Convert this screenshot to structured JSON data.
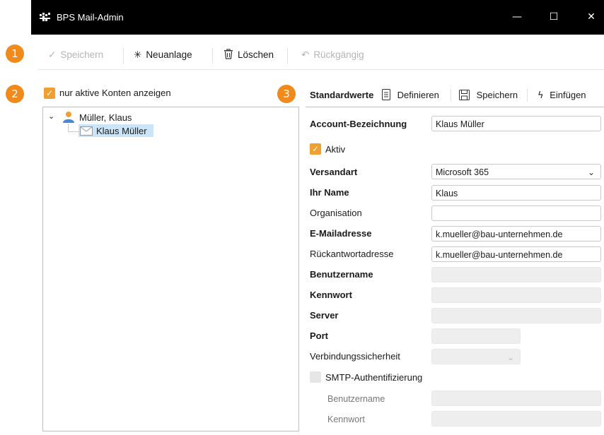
{
  "window": {
    "title": "BPS Mail-Admin",
    "minimize_glyph": "—",
    "maximize_glyph": "☐",
    "close_glyph": "✕"
  },
  "badges": [
    "1",
    "2",
    "3"
  ],
  "toolbar": {
    "save_label": "Speichern",
    "new_label": "Neuanlage",
    "delete_label": "Löschen",
    "undo_label": "Rückgängig",
    "save_icon": "check-icon",
    "new_icon": "asterisk-icon",
    "delete_icon": "trash-icon",
    "undo_icon": "undo-icon"
  },
  "filter": {
    "active_only_label": "nur aktive Konten anzeigen",
    "checked": true
  },
  "tree": {
    "nodes": [
      {
        "label": "Müller, Klaus",
        "icon": "user-icon",
        "expanded": true
      },
      {
        "label": "Klaus Müller",
        "icon": "envelope-icon",
        "selected": true
      }
    ]
  },
  "defaults_bar": {
    "title": "Standardwerte",
    "define_label": "Definieren",
    "save_label": "Speichern",
    "insert_label": "Einfügen"
  },
  "form": {
    "account_label": "Account-Bezeichnung",
    "account_value": "Klaus Müller",
    "active_label": "Aktiv",
    "send_type_label": "Versandart",
    "send_type_value": "Microsoft 365",
    "name_label": "Ihr Name",
    "name_value": "Klaus",
    "org_label": "Organisation",
    "org_value": "",
    "email_label": "E-Mailadresse",
    "email_value": "k.mueller@bau-unternehmen.de",
    "reply_label": "Rückantwortadresse",
    "reply_value": "k.mueller@bau-unternehmen.de",
    "username_label": "Benutzername",
    "password_label": "Kennwort",
    "server_label": "Server",
    "port_label": "Port",
    "security_label": "Verbindungssicherheit",
    "smtp_auth_label": "SMTP-Authentifizierung",
    "smtp_user_label": "Benutzername",
    "smtp_pass_label": "Kennwort"
  },
  "colors": {
    "accent": "#f08a1c",
    "checkbox": "#f0a030",
    "titlebar": "#000000",
    "selection": "#cce4f7"
  }
}
